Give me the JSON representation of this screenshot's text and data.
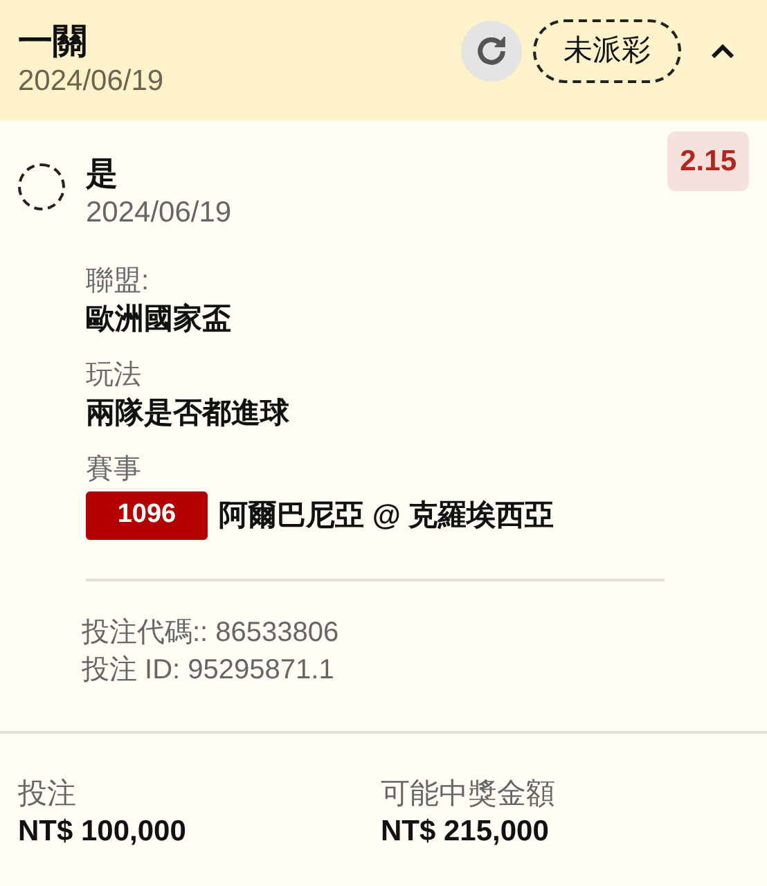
{
  "header": {
    "title": "一關",
    "date": "2024/06/19",
    "status": "未派彩",
    "expanded": true
  },
  "selection": {
    "name": "是",
    "date": "2024/06/19",
    "odds": "2.15",
    "checked": false,
    "details": [
      {
        "label": "聯盟:",
        "value": "歐洲國家盃"
      },
      {
        "label": "玩法",
        "value": "兩隊是否都進球"
      }
    ],
    "event": {
      "label": "賽事",
      "code": "1096",
      "teams": "阿爾巴尼亞 @ 克羅埃西亞"
    },
    "bet_code": "投注代碼:: 86533806",
    "bet_id": "投注 ID: 95295871.1"
  },
  "footer": [
    {
      "label": "投注",
      "value": "NT$ 100,000"
    },
    {
      "label": "可能中獎金額",
      "value": "NT$ 215,000"
    }
  ]
}
